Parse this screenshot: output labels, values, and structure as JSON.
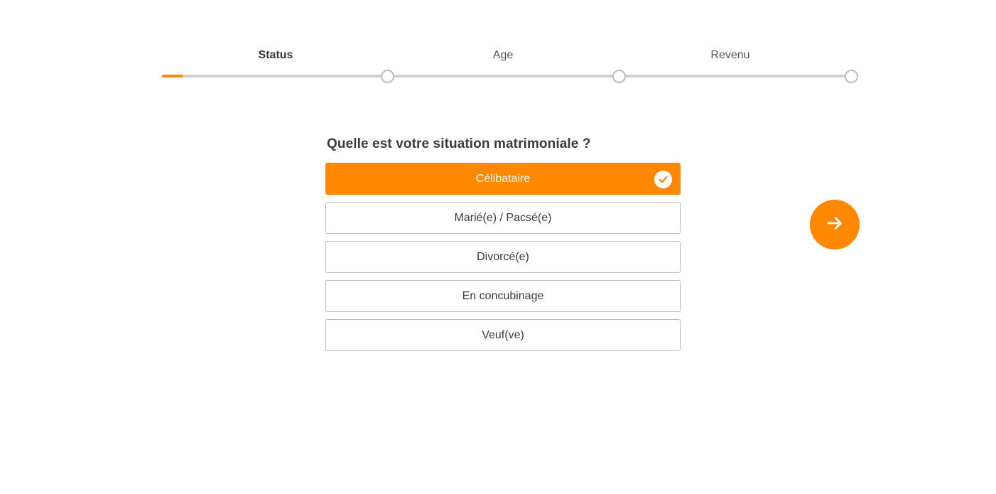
{
  "stepper": {
    "steps": [
      {
        "label": "Status",
        "active": true
      },
      {
        "label": "Age",
        "active": false
      },
      {
        "label": "Revenu",
        "active": false
      }
    ],
    "progress_fraction": 0.03
  },
  "question": {
    "title": "Quelle est votre situation matrimoniale ?",
    "options": [
      {
        "label": "Célibataire",
        "selected": true
      },
      {
        "label": "Marié(e) / Pacsé(e)",
        "selected": false
      },
      {
        "label": "Divorcé(e)",
        "selected": false
      },
      {
        "label": "En concubinage",
        "selected": false
      },
      {
        "label": "Veuf(ve)",
        "selected": false
      }
    ]
  },
  "icons": {
    "selected_check": "check-icon",
    "next": "arrow-right-icon"
  },
  "colors": {
    "accent": "#ff8800",
    "track": "#cfcfcf",
    "text": "#3a3a3a",
    "border": "#bdbdbd"
  }
}
